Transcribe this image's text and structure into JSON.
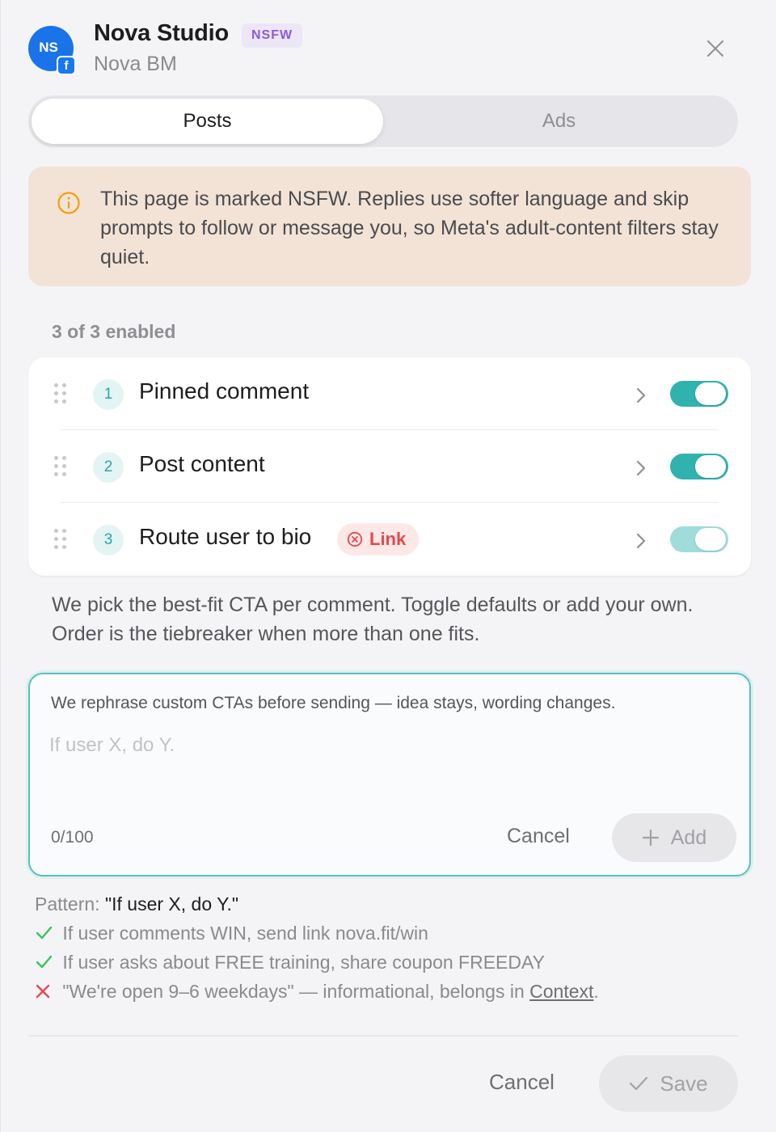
{
  "header": {
    "avatar_initials": "NS",
    "platform_icon": "facebook-icon",
    "title": "Nova Studio",
    "badge": "NSFW",
    "subtitle": "Nova BM",
    "close_icon": "close-icon"
  },
  "tabs": [
    {
      "label": "Posts",
      "active": true
    },
    {
      "label": "Ads",
      "active": false
    }
  ],
  "notice": {
    "icon": "info-icon",
    "text": "This page is marked NSFW. Replies use softer language and skip prompts to follow or message you, so Meta's adult-content filters stay quiet."
  },
  "enabled_count": "3 of 3 enabled",
  "ctas": [
    {
      "number": "1",
      "label": "Pinned comment",
      "enabled": true
    },
    {
      "number": "2",
      "label": "Post content",
      "enabled": true
    },
    {
      "number": "3",
      "label": "Route user to bio",
      "badge": "Link",
      "badge_icon": "error-circle-icon",
      "enabled": true
    }
  ],
  "help_text": "We pick the best-fit CTA per comment. Toggle defaults or add your own. Order is the tiebreaker when more than one fits.",
  "composer": {
    "hint": "We rephrase custom CTAs before sending — idea stays, wording changes.",
    "value": "",
    "placeholder": "If user X, do Y.",
    "char_count": "0/100",
    "cancel_label": "Cancel",
    "add_label": "Add"
  },
  "pattern": {
    "key": "Pattern:",
    "value": "\"If user X, do Y.\"",
    "examples": [
      {
        "ok": true,
        "text": "If user comments WIN, send link nova.fit/win"
      },
      {
        "ok": true,
        "text": "If user asks about FREE training, share coupon FREEDAY"
      },
      {
        "ok": false,
        "text": "\"We're open 9–6 weekdays\" — informational, belongs in ",
        "link": "Context",
        "suffix": "."
      }
    ]
  },
  "footer": {
    "cancel_label": "Cancel",
    "save_label": "Save"
  },
  "colors": {
    "accent": "#30b2ae",
    "notice_bg": "#f2e3d6",
    "nsfw_badge": "#8b5cd6",
    "error": "#e5484d",
    "success": "#34c759"
  }
}
